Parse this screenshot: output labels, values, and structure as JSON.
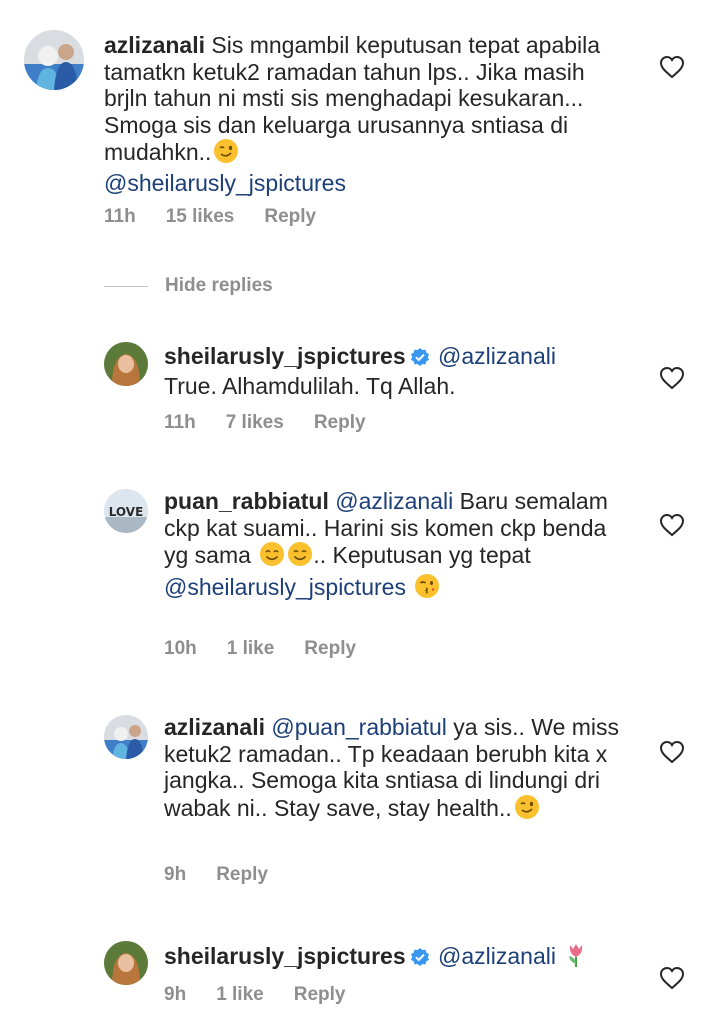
{
  "comments": [
    {
      "username": "azlizanali",
      "mention": "",
      "text": " Sis mngambil keputusan tepat apabila tamatkn ketuk2 ramadan tahun lps.. Jika masih brjln tahun ni msti sis menghadapi kesukaran... Smoga sis dan keluarga urusannya sntiasa di mudahkn..",
      "emoji": "winking-face",
      "trailing_mention": "@sheilarusly_jspictures",
      "time": "11h",
      "likes": "15 likes",
      "reply": "Reply"
    },
    {
      "username": "sheilarusly_jspictures",
      "verified": true,
      "mention": "@azlizanali",
      "text": "True. Alhamdulilah. Tq Allah.",
      "time": "11h",
      "likes": "7 likes",
      "reply": "Reply"
    },
    {
      "username": "puan_rabbiatul",
      "mention": "@azlizanali",
      "text": " Baru semalam ckp kat suami.. Harini sis komen ckp benda yg sama",
      "text_after_emojis": ".. Keputusan yg tepat",
      "trailing_mention": "@sheilarusly_jspictures",
      "time": "10h",
      "likes": "1 like",
      "reply": "Reply"
    },
    {
      "username": "azlizanali",
      "mention": "@puan_rabbiatul",
      "text": " ya sis.. We miss ketuk2 ramadan.. Tp keadaan berubh kita x jangka.. Semoga kita sntiasa di lindungi dri wabak ni.. Stay save, stay health..",
      "time": "9h",
      "reply": "Reply"
    },
    {
      "username": "sheilarusly_jspictures",
      "verified": true,
      "mention": "@azlizanali",
      "emoji": "tulip",
      "time": "9h",
      "likes": "1 like",
      "reply": "Reply"
    }
  ],
  "hide_replies": "Hide replies",
  "colors": {
    "text": "#262626",
    "meta": "#8e8e8e",
    "mention": "#1c3f78",
    "verified": "#3897f0"
  }
}
